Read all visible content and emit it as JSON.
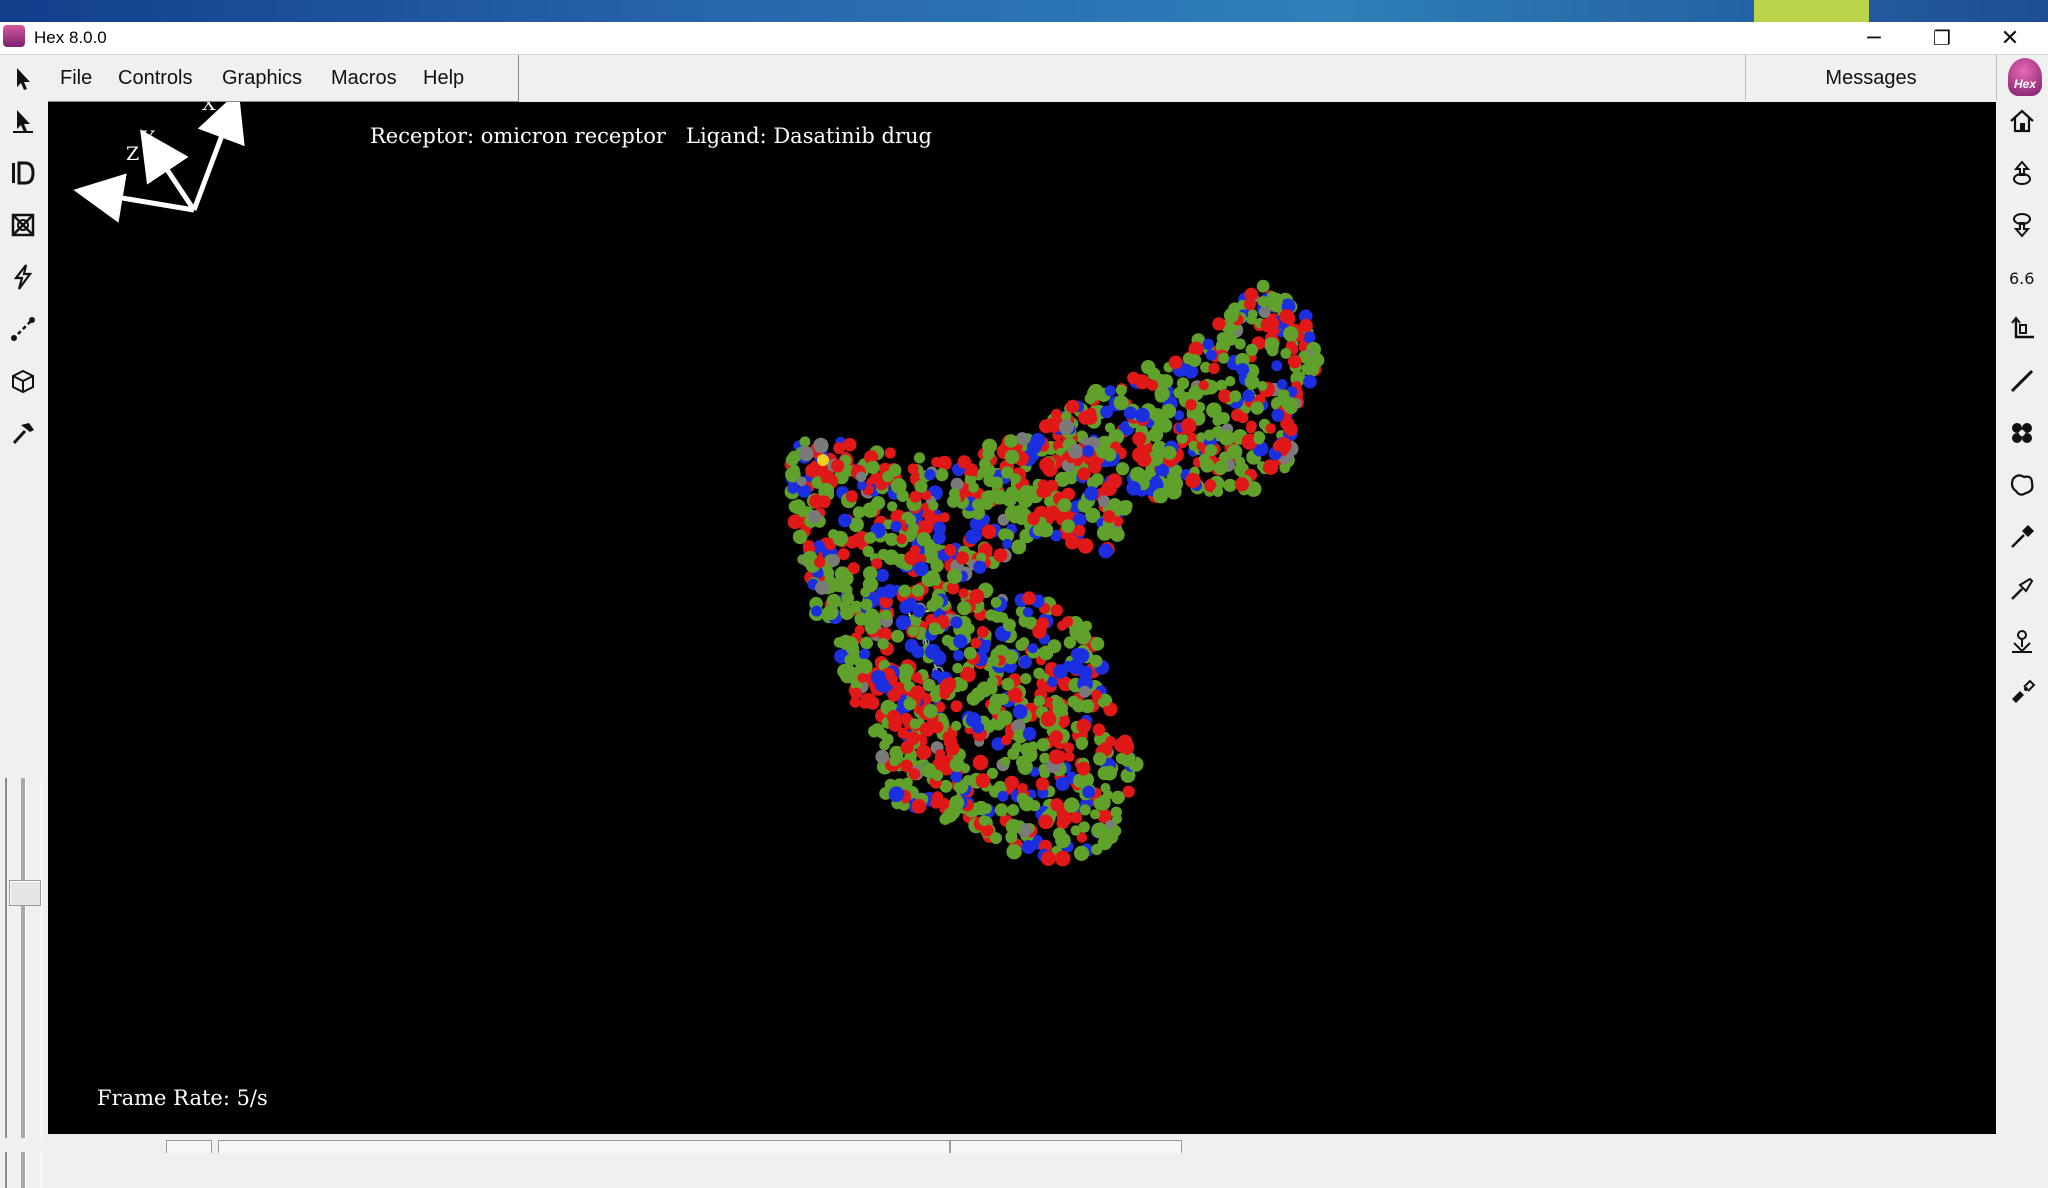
{
  "window": {
    "title": "Hex 8.0.0",
    "minimize_glyph": "─",
    "maximize_glyph": "❐",
    "close_glyph": "✕"
  },
  "menu": {
    "items": [
      "File",
      "Controls",
      "Graphics",
      "Macros",
      "Help"
    ]
  },
  "messages_button": "Messages",
  "logo_text": "Hex",
  "viewport": {
    "axes": {
      "x": "X",
      "y": "Y",
      "z": "Z"
    },
    "receptor_label": "Receptor: omicron receptor",
    "ligand_label": "Ligand: Dasatinib drug",
    "frame_rate": "Frame Rate: 5/s",
    "atom_colors": [
      "#5fa12a",
      "#e01818",
      "#1b2ee0",
      "#7a7a7a"
    ],
    "background": "#000000"
  },
  "left_tools": [
    "pointer-icon",
    "select-arrow-icon",
    "id-label-icon",
    "crossed-box-icon",
    "lightning-icon",
    "measure-icon",
    "cube-edit-icon",
    "hammer-icon"
  ],
  "right_tools": [
    "home-icon",
    "rotate-up-icon",
    "rotate-down-icon",
    "distance-icon",
    "axis-frame-icon",
    "line-icon",
    "molecule-icon",
    "surface-icon",
    "pipette-icon",
    "probe-icon",
    "anchor-icon",
    "docking-icon"
  ],
  "accent_colors": {
    "titlebar_band": "#2766ad",
    "band_accent": "#b9d44a"
  }
}
